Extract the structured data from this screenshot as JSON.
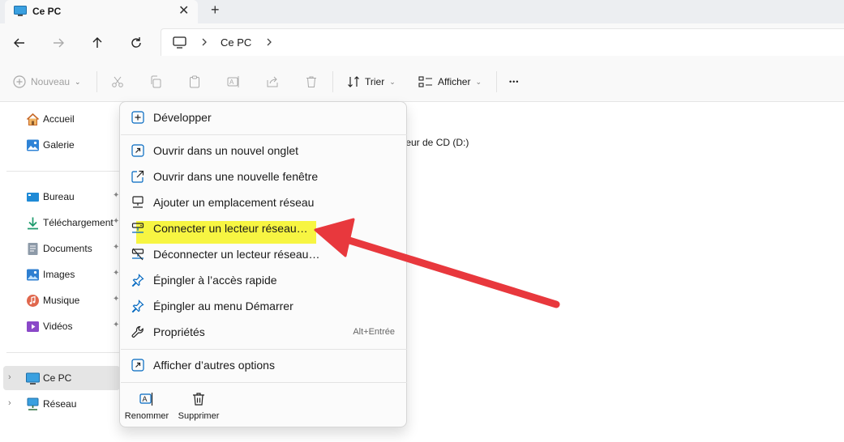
{
  "tab": {
    "title": "Ce PC",
    "close_glyph": "✕",
    "add_glyph": "+"
  },
  "address": {
    "crumb": "Ce PC"
  },
  "command_bar": {
    "new_label": "Nouveau",
    "sort_label": "Trier",
    "view_label": "Afficher",
    "more_glyph": "•••"
  },
  "sidebar": {
    "items": [
      {
        "label": "Accueil",
        "icon": "home-icon"
      },
      {
        "label": "Galerie",
        "icon": "gallery-icon"
      },
      {
        "label": "Bureau",
        "icon": "desktop-folder-icon",
        "pinned": true
      },
      {
        "label": "Téléchargement",
        "icon": "download-icon",
        "pinned": true
      },
      {
        "label": "Documents",
        "icon": "documents-icon",
        "pinned": true
      },
      {
        "label": "Images",
        "icon": "images-icon",
        "pinned": true
      },
      {
        "label": "Musique",
        "icon": "music-icon",
        "pinned": true
      },
      {
        "label": "Vidéos",
        "icon": "videos-icon",
        "pinned": true
      },
      {
        "label": "Ce PC",
        "icon": "pc-icon",
        "selected": true
      },
      {
        "label": "Réseau",
        "icon": "network-icon"
      }
    ]
  },
  "main": {
    "partial_drive_label": "teur de CD (D:)"
  },
  "context_menu": {
    "items": [
      {
        "label": "Développer",
        "icon": "expand-icon"
      },
      {
        "label": "Ouvrir dans un nouvel onglet",
        "icon": "open-new-tab-icon"
      },
      {
        "label": "Ouvrir dans une nouvelle fenêtre",
        "icon": "open-new-window-icon"
      },
      {
        "label": "Ajouter un emplacement réseau",
        "icon": "add-network-location-icon"
      },
      {
        "label": "Connecter un lecteur réseau…",
        "icon": "map-network-drive-icon",
        "highlighted": true
      },
      {
        "label": "Déconnecter un lecteur réseau…",
        "icon": "disconnect-network-drive-icon"
      },
      {
        "label": "Épingler à l’accès rapide",
        "icon": "pin-icon"
      },
      {
        "label": "Épingler au menu Démarrer",
        "icon": "pin-start-icon"
      },
      {
        "label": "Propriétés",
        "icon": "properties-icon",
        "shortcut": "Alt+Entrée"
      },
      {
        "label": "Afficher d’autres options",
        "icon": "more-options-icon"
      }
    ],
    "bottom_actions": [
      {
        "label": "Renommer",
        "icon": "rename-icon"
      },
      {
        "label": "Supprimer",
        "icon": "delete-icon"
      }
    ]
  },
  "colors": {
    "highlight": "#f7f542",
    "annotation_arrow": "#e8383d",
    "accent": "#0067c0"
  }
}
